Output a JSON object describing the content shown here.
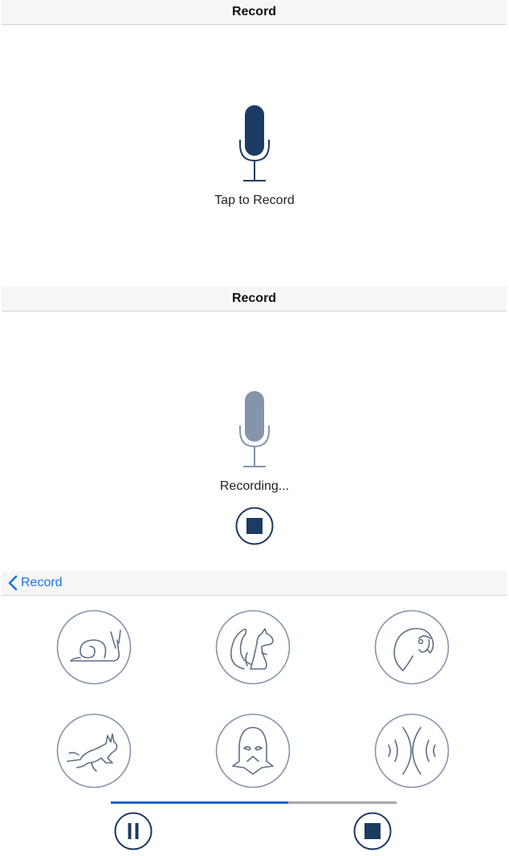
{
  "screen1": {
    "nav_title": "Record",
    "caption": "Tap to Record",
    "mic_color": "#1c3b63"
  },
  "screen2": {
    "nav_title": "Record",
    "caption": "Recording...",
    "mic_color": "#8494ab"
  },
  "screen3": {
    "back_label": "Record",
    "accent_color": "#1a73e8",
    "effects": [
      {
        "icon": "snail-icon"
      },
      {
        "icon": "squirrel-icon"
      },
      {
        "icon": "parrot-icon"
      },
      {
        "icon": "rabbit-icon"
      },
      {
        "icon": "darth-vader-icon"
      },
      {
        "icon": "echo-icon"
      }
    ],
    "playback_progress": 0.62
  }
}
